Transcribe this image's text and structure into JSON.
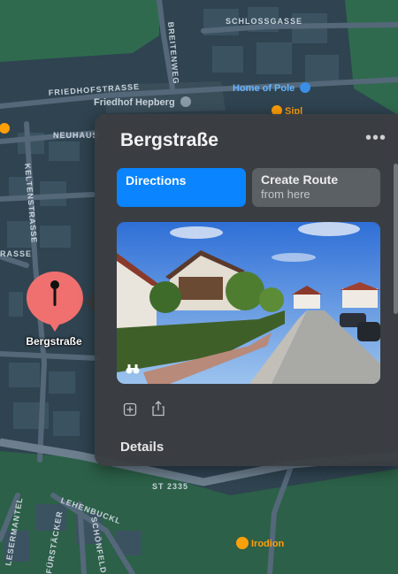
{
  "map": {
    "streets": [
      "SCHLOSSGASSE",
      "BREITENWEG",
      "FRIEDHOFSTRASSE",
      "NEUHAUS",
      "KELTENSTRASSE",
      "RASSE",
      "ST 2335",
      "LEHENBUCKL",
      "LESERMANTEL",
      "FÜRSTÄCKER",
      "SCHÖNFELD"
    ],
    "pois": {
      "cemetery": "Friedhof Hepberg",
      "home": "Home of Pole",
      "restaurant_sipl": "Sipl",
      "restaurant_irodion": "Irodion"
    }
  },
  "pin": {
    "label": "Bergstraße",
    "color": "#f07070"
  },
  "card": {
    "title": "Bergstraße",
    "more": "•••",
    "directions_label": "Directions",
    "create_route_label": "Create Route",
    "create_route_sub": "from here",
    "details_label": "Details"
  },
  "icons": {
    "lookaround": "binoculars-icon",
    "add": "plus-square-icon",
    "share": "share-icon"
  },
  "colors": {
    "accent": "#0a84ff",
    "map_bg": "#2f4350",
    "green": "#2f6a4e",
    "poi_orange": "#ff9f0a",
    "poi_blue": "#64b5ff"
  }
}
